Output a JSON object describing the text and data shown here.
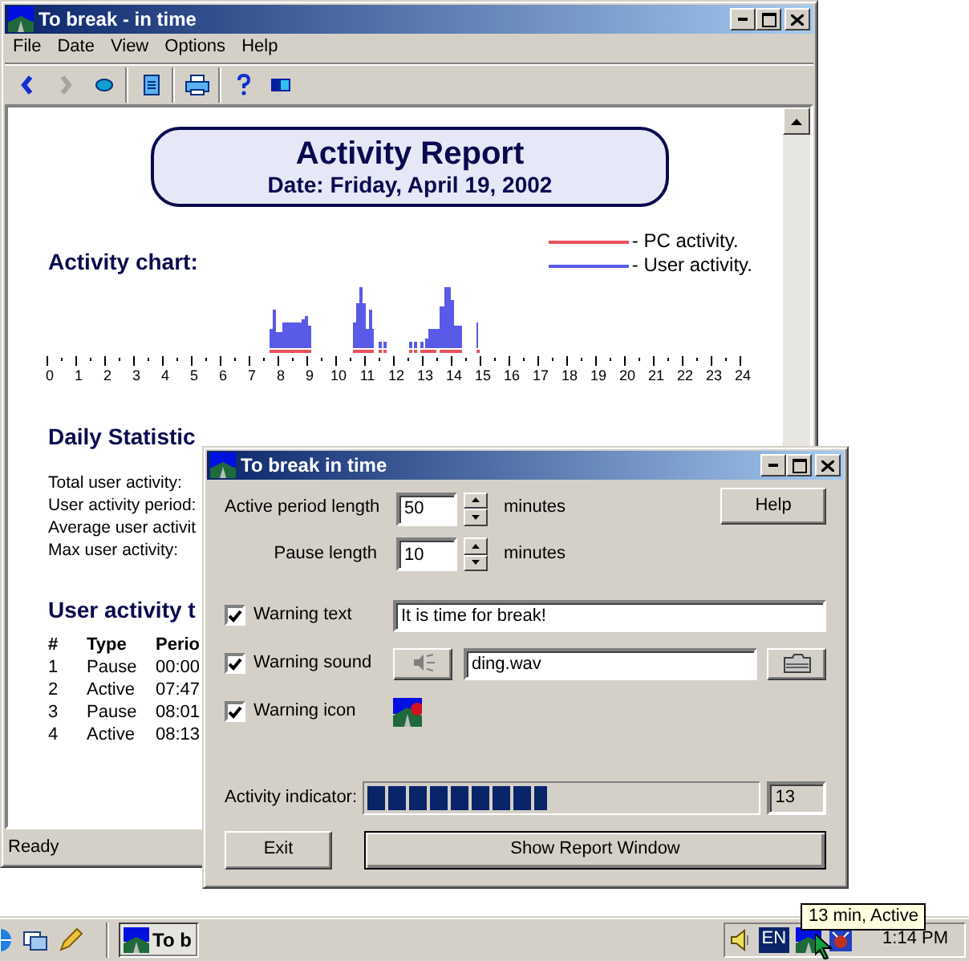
{
  "main_window": {
    "title": "To break - in time",
    "menu": [
      "File",
      "Date",
      "View",
      "Options",
      "Help"
    ],
    "toolbar": [
      {
        "kind": "back",
        "disabled": false
      },
      {
        "kind": "forward",
        "disabled": true
      },
      {
        "kind": "home",
        "disabled": false
      },
      {
        "kind": "separator"
      },
      {
        "kind": "document",
        "disabled": false
      },
      {
        "kind": "separator"
      },
      {
        "kind": "print",
        "disabled": false
      },
      {
        "kind": "separator"
      },
      {
        "kind": "help",
        "disabled": false
      },
      {
        "kind": "window",
        "disabled": false
      }
    ],
    "report": {
      "title": "Activity Report",
      "date": "Date: Friday, April 19, 2002",
      "chart_heading": "Activity chart:",
      "legend": [
        {
          "label": "- PC activity.",
          "color": "#e8505a"
        },
        {
          "label": "- User activity.",
          "color": "#5a5ae8"
        }
      ],
      "axis_labels": [
        "0",
        "1",
        "2",
        "3",
        "4",
        "5",
        "6",
        "7",
        "8",
        "9",
        "10",
        "11",
        "12",
        "13",
        "14",
        "15",
        "16",
        "17",
        "18",
        "19",
        "20",
        "21",
        "22",
        "23",
        "24"
      ],
      "stats_heading": "Daily Statistic",
      "stats": [
        "Total user activity:",
        "User activity period:",
        "Average user activit",
        "Max user activity:"
      ],
      "table_heading": "User activity t",
      "table": {
        "columns": [
          "#",
          "Type",
          "Perio"
        ],
        "rows": [
          [
            "1",
            "Pause",
            "00:00"
          ],
          [
            "2",
            "Active",
            "07:47"
          ],
          [
            "3",
            "Pause",
            "08:01"
          ],
          [
            "4",
            "Active",
            "08:13"
          ]
        ]
      }
    },
    "status_bar": "Ready"
  },
  "dialog": {
    "title": "To break in time",
    "active_period": {
      "label": "Active period length",
      "value": "50",
      "unit": "minutes"
    },
    "pause": {
      "label": "Pause length",
      "value": "10",
      "unit": "minutes"
    },
    "help_button": "Help",
    "warnings": [
      {
        "kind": "text",
        "label": "Warning text",
        "checked": true,
        "value": "It is time for break!"
      },
      {
        "kind": "sound",
        "label": "Warning sound",
        "checked": true,
        "value": "ding.wav"
      },
      {
        "kind": "icon",
        "label": "Warning icon",
        "checked": true
      }
    ],
    "activity": {
      "label": "Activity indicator:",
      "level": 0.46,
      "reading": "13"
    },
    "buttons": [
      "Exit",
      "Show Report Window"
    ]
  },
  "taskbar": {
    "task_button": "To b",
    "language": "EN",
    "clock": "1:14 PM",
    "tooltip": "13 min, Active"
  }
}
